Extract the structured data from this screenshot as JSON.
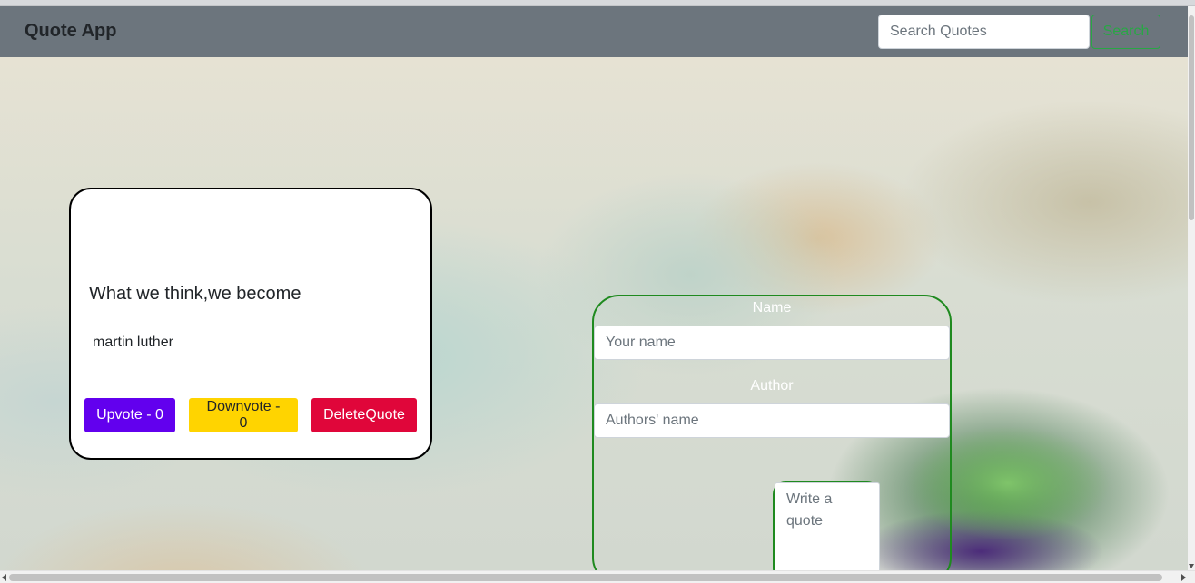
{
  "navbar": {
    "brand": "Quote App",
    "search_placeholder": "Search Quotes",
    "search_button": "Search"
  },
  "quote_card": {
    "text": "What we think,we become",
    "author": "martin luther",
    "upvote_label": "Upvote - 0",
    "downvote_label": "Downvote - 0",
    "delete_label": "DeleteQuote"
  },
  "form": {
    "name_label": "Name",
    "name_placeholder": "Your name",
    "author_label": "Author",
    "author_placeholder": "Authors' name",
    "quote_placeholder": "Write a quote"
  },
  "colors": {
    "navbar": "#6c757d",
    "search_accent": "#28a745",
    "upvote": "#6200ee",
    "downvote": "#ffd400",
    "delete": "#e0063a",
    "form_border": "#1f8a1f"
  }
}
